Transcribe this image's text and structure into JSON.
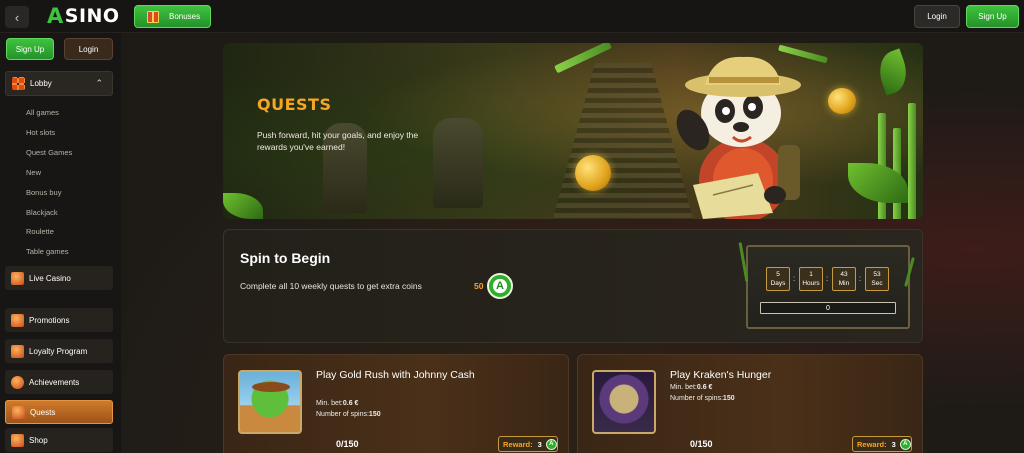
{
  "topbar": {
    "back_icon": "chevron-left-icon",
    "logo_mark": "A",
    "logo_text": "SINO",
    "bonuses_label": "Bonuses",
    "login_label": "Login",
    "signup_label": "Sign Up"
  },
  "sidebar": {
    "signup_label": "Sign Up",
    "login_label": "Login",
    "lobby_label": "Lobby",
    "lobby_chevron": "^",
    "sub_items": [
      "All games",
      "Hot slots",
      "Quest Games",
      "New",
      "Bonus buy",
      "Blackjack",
      "Roulette",
      "Table games"
    ],
    "items": [
      {
        "label": "Live Casino",
        "icon": "dealer-icon"
      },
      {
        "label": "Promotions",
        "icon": "megaphone-icon"
      },
      {
        "label": "Loyalty Program",
        "icon": "medal-icon"
      },
      {
        "label": "Achievements",
        "icon": "target-icon"
      },
      {
        "label": "Quests",
        "icon": "quest-icon",
        "active": true
      },
      {
        "label": "Shop",
        "icon": "shop-icon"
      }
    ]
  },
  "hero": {
    "title": "QUESTS",
    "description": "Push forward, hit your goals, and enjoy the rewards you've earned!"
  },
  "spin": {
    "title": "Spin to Begin",
    "description": "Complete all 10 weekly quests to get extra coins",
    "amount": "50",
    "badge": "A",
    "timer": [
      {
        "value": "5",
        "unit": "Days"
      },
      {
        "value": "1",
        "unit": "Hours"
      },
      {
        "value": "43",
        "unit": "Min"
      },
      {
        "value": "53",
        "unit": "Sec"
      }
    ],
    "progress": "0"
  },
  "quests": [
    {
      "title": "Play Gold Rush with Johnny Cash",
      "min_bet_label": "Min. bet:",
      "min_bet": "0.6 €",
      "spins_label": "Number of spins:",
      "spins": "150",
      "progress": "0/150",
      "reward_label": "Reward:",
      "reward": "3",
      "reward_badge": "A"
    },
    {
      "title": "Play Kraken's Hunger",
      "min_bet_label": "Min. bet:",
      "min_bet": "0.6 €",
      "spins_label": "Number of spins:",
      "spins": "150",
      "progress": "0/150",
      "reward_label": "Reward:",
      "reward": "3",
      "reward_badge": "A"
    }
  ],
  "colors": {
    "accent_green": "#2fae2c",
    "accent_orange": "#f5a623",
    "active_item": "#c06c24"
  }
}
